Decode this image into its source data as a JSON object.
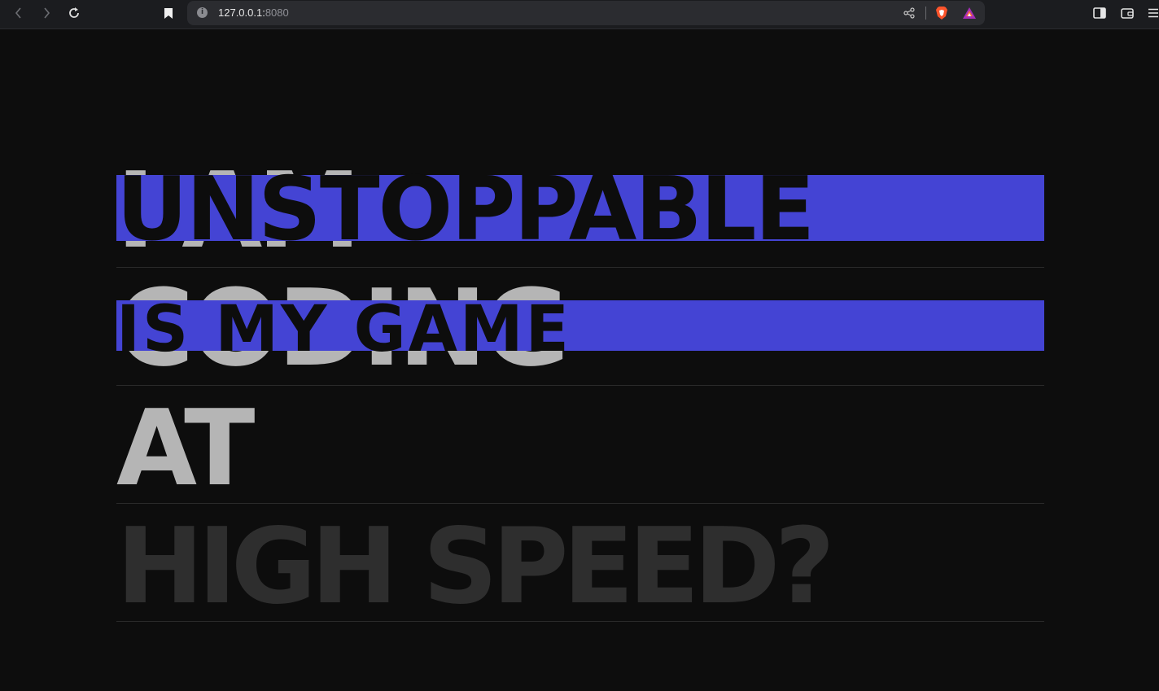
{
  "browser": {
    "url_host": "127.0.0.1:",
    "url_port": "8080"
  },
  "hero": {
    "row1_back": "I AM",
    "row1_front": "UNSTOPPABLE",
    "row2_back": "CODING",
    "row2_front": "IS MY GAME",
    "row3": "AT",
    "row4": "HIGH SPEED?"
  },
  "colors": {
    "background": "#0d0d0d",
    "accent_band": "#4444d4",
    "light_text": "#b5b5b5",
    "dim_text": "#2e2e2e"
  }
}
